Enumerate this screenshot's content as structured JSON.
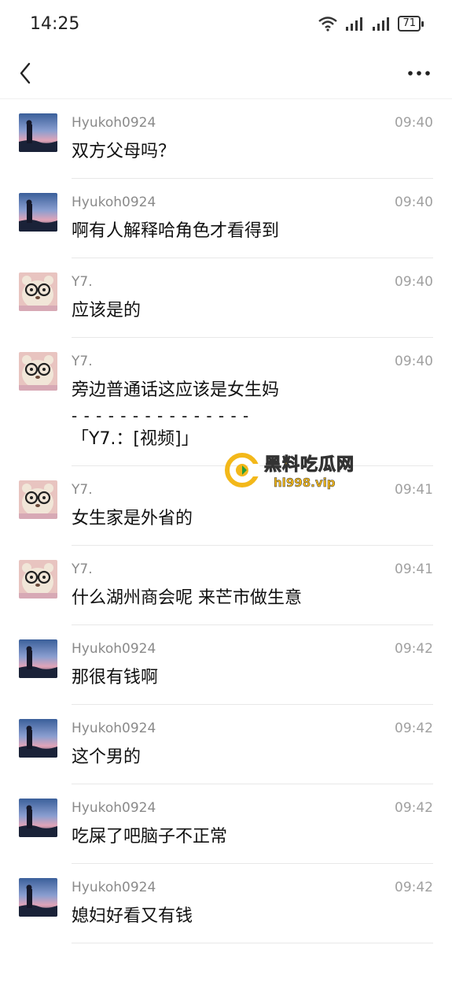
{
  "status_bar": {
    "time": "14:25",
    "battery": "71",
    "icons": [
      "wifi-icon",
      "signal-icon",
      "signal-icon",
      "battery-icon"
    ]
  },
  "nav": {
    "back_icon": "chevron-left-icon",
    "more_icon": "more-horizontal-icon"
  },
  "messages": [
    {
      "sender": "Hyukoh0924",
      "time": "09:40",
      "text": "双方父母吗？",
      "avatar": "landscape"
    },
    {
      "sender": "Hyukoh0924",
      "time": "09:40",
      "text": "啊有人解释哈角色才看得到",
      "avatar": "landscape"
    },
    {
      "sender": "Y7.",
      "time": "09:40",
      "text": "应该是的",
      "avatar": "bear"
    },
    {
      "sender": "Y7.",
      "time": "09:40",
      "text": "旁边普通话这应该是女生妈",
      "avatar": "bear",
      "quote_separator": "- - - - - - - - - - - - - - -",
      "quote": "「Y7.：[视频]」"
    },
    {
      "sender": "Y7.",
      "time": "09:41",
      "text": "女生家是外省的",
      "avatar": "bear"
    },
    {
      "sender": "Y7.",
      "time": "09:41",
      "text": "什么湖州商会呢 来芒市做生意",
      "avatar": "bear"
    },
    {
      "sender": "Hyukoh0924",
      "time": "09:42",
      "text": "那很有钱啊",
      "avatar": "landscape"
    },
    {
      "sender": "Hyukoh0924",
      "time": "09:42",
      "text": "这个男的",
      "avatar": "landscape"
    },
    {
      "sender": "Hyukoh0924",
      "time": "09:42",
      "text": "吃屎了吧脑子不正常",
      "avatar": "landscape"
    },
    {
      "sender": "Hyukoh0924",
      "time": "09:42",
      "text": "媳妇好看又有钱",
      "avatar": "landscape"
    }
  ],
  "watermark": {
    "title": "黑料吃瓜网",
    "url": "hl998.vip"
  }
}
